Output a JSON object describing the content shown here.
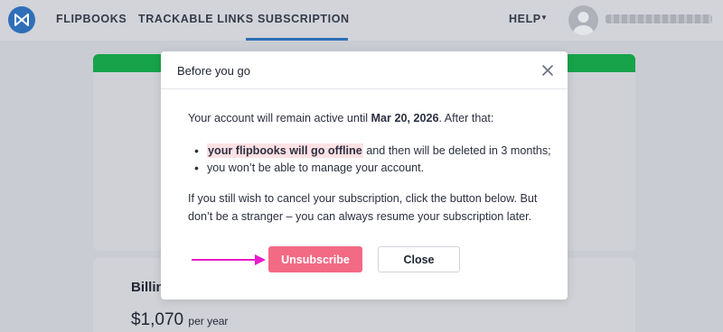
{
  "nav": {
    "items": [
      {
        "label": "FLIPBOOKS"
      },
      {
        "label": "TRACKABLE LINKS"
      },
      {
        "label": "SUBSCRIPTION"
      }
    ],
    "help_label": "HELP",
    "active_item": "SUBSCRIPTION"
  },
  "background": {
    "billing_label": "Billin",
    "price": "$1,070",
    "price_unit": "per year"
  },
  "modal": {
    "title": "Before you go",
    "active_prefix": "Your account will remain active until ",
    "active_date": "Mar 20, 2026",
    "active_suffix": ". After that:",
    "bullet1_highlight": "your flipbooks will go offline",
    "bullet1_rest": " and then will be deleted in 3 months;",
    "bullet2": "you won’t be able to manage your account.",
    "cancel_line1": "If you still wish to cancel your subscription, click the button below. But",
    "cancel_line2": "don’t be a stranger – you can always resume your subscription later.",
    "unsubscribe_label": "Unsubscribe",
    "close_label": "Close"
  },
  "colors": {
    "brand": "#2f6fb8",
    "success_strip": "#17a34a",
    "unsubscribe": "#f26a84",
    "highlight": "#fde1e4",
    "arrow": "#e81ac9"
  },
  "icons": {
    "logo": "flipbook-logo-icon",
    "help_caret": "caret-down-icon",
    "avatar": "user-avatar-icon",
    "modal_close": "close-icon",
    "annotation": "arrow-right-icon"
  }
}
